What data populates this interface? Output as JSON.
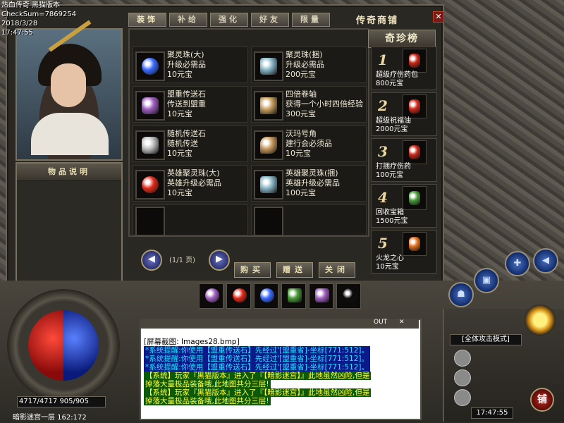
{
  "overlay": {
    "line1": "热血传奇 黑猫版本",
    "line2": "CheckSum=7869254",
    "line3": "2018/3/28",
    "line4": "17:47:55"
  },
  "shop": {
    "title": "传奇商铺",
    "tabs": [
      "装饰",
      "补给",
      "强化",
      "好友",
      "限量"
    ],
    "desc_title": "物品说明",
    "items": [
      {
        "name": "聚灵珠(大)",
        "desc": "升级必需品",
        "price": "10元宝",
        "icon_color": "#3a6aff"
      },
      {
        "name": "聚灵珠(捆)",
        "desc": "升级必需品",
        "price": "200元宝",
        "icon_color": "#8ab8c8"
      },
      {
        "name": "盟重传送石",
        "desc": "传送到盟重",
        "price": "10元宝",
        "icon_color": "#a060c0"
      },
      {
        "name": "四倍卷轴",
        "desc": "获得一个小时四倍经验",
        "price": "300元宝",
        "icon_color": "#c8a060"
      },
      {
        "name": "随机传送石",
        "desc": "随机传送",
        "price": "10元宝",
        "icon_color": "#c0c0c0"
      },
      {
        "name": "沃玛号角",
        "desc": "建行会必须品",
        "price": "10元宝",
        "icon_color": "#c89a60"
      },
      {
        "name": "英雄聚灵珠(大)",
        "desc": "英雄升级必需品",
        "price": "10元宝",
        "icon_color": "#e02a1a"
      },
      {
        "name": "英雄聚灵珠(捆)",
        "desc": "英雄升级必需品",
        "price": "100元宝",
        "icon_color": "#8ab8c8"
      }
    ],
    "page": "(1/1 页)",
    "prev": "◀",
    "next": "▶",
    "buy": "购买",
    "gift": "赠送",
    "close": "关闭",
    "close_x": "✕"
  },
  "rank": {
    "title": "奇珍榜",
    "items": [
      {
        "num": "1",
        "name": "超级疗伤药包",
        "price": "800元宝",
        "icon_color": "#c8281a"
      },
      {
        "name": "超级祝福油",
        "num": "2",
        "price": "2000元宝",
        "icon_color": "#d02a1a"
      },
      {
        "num": "3",
        "name": "打捆疗伤药",
        "price": "100元宝",
        "icon_color": "#c8281a"
      },
      {
        "num": "4",
        "name": "回收宝箱",
        "price": "1500元宝",
        "icon_color": "#4a9a3a"
      },
      {
        "num": "5",
        "name": "火龙之心",
        "price": "10元宝",
        "icon_color": "#e07020"
      }
    ]
  },
  "hud": {
    "hpmp": "4717/4717  905/905",
    "map": "暗影迷宫一层  162:172",
    "attack_mode": "[全体攻击模式]",
    "clock": "17:47:55",
    "shop_btn": "铺",
    "chat_out": "OUT",
    "chat_close": "✕",
    "belt": [
      {
        "icon": "scroll-icon",
        "color": "#a060c0"
      },
      {
        "icon": "red-orb-icon",
        "color": "#e02a1a"
      },
      {
        "icon": "blue-orb-icon",
        "color": "#3a6aff"
      },
      {
        "icon": "chest-icon",
        "color": "#4a9a3a"
      },
      {
        "icon": "stone-icon",
        "color": "#a060c0"
      },
      {
        "icon": "empty-slot",
        "color": "#0c0b0a"
      }
    ]
  },
  "chat": {
    "lines": [
      {
        "style": "plain",
        "text": "[屏幕截图: Images28.bmp]"
      },
      {
        "style": "sys",
        "text": "*系统提醒:你使用【盟重传送石】先经过'[盟重省]-坐标[771:512]。"
      },
      {
        "style": "sys",
        "text": "*系统提醒:你使用【盟重传送石】先经过'[盟重省]-坐标[771:512]。"
      },
      {
        "style": "sys",
        "text": "*系统提醒:你使用【盟重传送石】先经过'[盟重省]-坐标[771:512]。"
      },
      {
        "style": "grn-y",
        "text": "【系统】玩家『黑猫版本』进入了『【暗影迷宫】』此地虽然凶险,但是"
      },
      {
        "style": "grn",
        "text": " 掉落大量极品装备哦,此地图共分三层!"
      },
      {
        "style": "grn-y",
        "text": "【系统】玩家『黑猫版本』进入了『【暗影迷宫】』此地虽然凶险,但是"
      },
      {
        "style": "grn",
        "text": " 掉落大量极品装备哦,此地图共分三层!"
      }
    ]
  }
}
